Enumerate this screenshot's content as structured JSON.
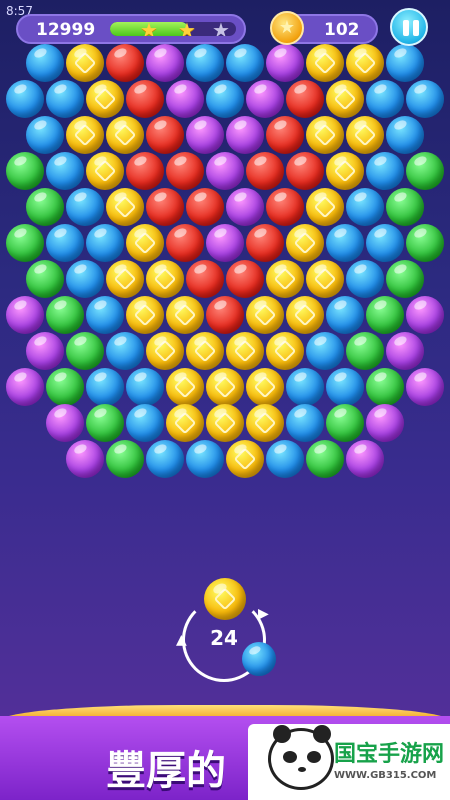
{
  "status_bar": {
    "time": "8:57"
  },
  "hud": {
    "score": "12999",
    "progress": 0.62,
    "stars": [
      "earned",
      "earned",
      "empty"
    ],
    "coins": "102",
    "pause_icon": "pause-icon"
  },
  "field": {
    "colors": {
      "B": "#1f8be8",
      "Y": "#f7b80a",
      "R": "#e52a1e",
      "P": "#a43ee0",
      "G": "#2fbf3a"
    },
    "rows": [
      "BYRPBBPYYB",
      "BBYRPBPRYBB",
      "BYYRPPRYYB",
      "GBYRRPRRYBG",
      "GBYRRPRYBG",
      "GBBYRPRYBBG",
      "GBYYRRYYBG",
      "PGBYYRYYBGP",
      "PGBYYYYBGP",
      "PGBBYYYBBGP",
      "PGBYYYBGP",
      "PGBBYBGP"
    ]
  },
  "shooter": {
    "shots_left": "24",
    "current_ball": "Y",
    "next_ball": "B"
  },
  "banner": {
    "text": "豐厚的",
    "strip_color": "#f2a11c"
  },
  "watermark": {
    "brand": "国宝手游网",
    "url": "WWW.GB315.COM"
  }
}
